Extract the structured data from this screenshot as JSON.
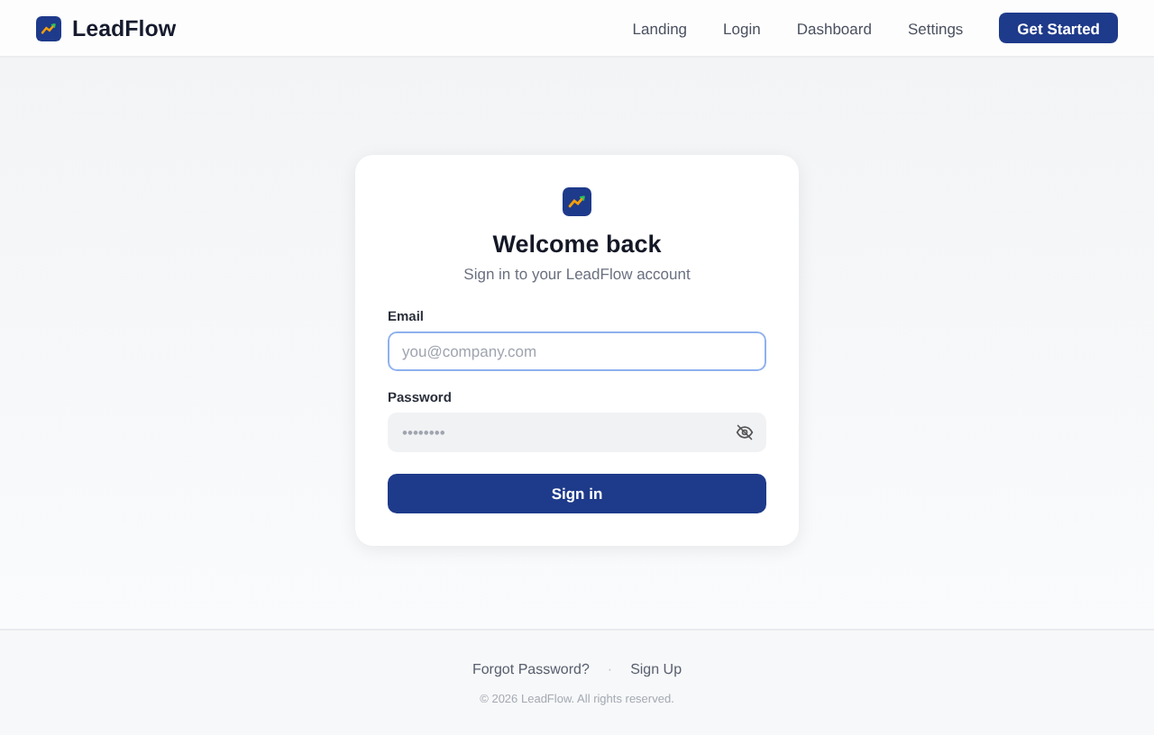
{
  "header": {
    "brand": "LeadFlow",
    "nav": [
      {
        "label": "Landing"
      },
      {
        "label": "Login"
      },
      {
        "label": "Dashboard"
      },
      {
        "label": "Settings"
      }
    ],
    "cta": "Get Started"
  },
  "card": {
    "title": "Welcome back",
    "subtitle": "Sign in to your LeadFlow account",
    "fields": [
      {
        "label": "Email",
        "placeholder": "you@company.com",
        "focused": true,
        "kind": "text"
      },
      {
        "label": "Password",
        "placeholder": "••••••••",
        "focused": false,
        "kind": "password"
      }
    ],
    "submit": "Sign in"
  },
  "footer": {
    "links": [
      "Forgot Password?",
      "Sign Up"
    ],
    "separator": "·",
    "copyright": "© 2026 LeadFlow. All rights reserved."
  }
}
